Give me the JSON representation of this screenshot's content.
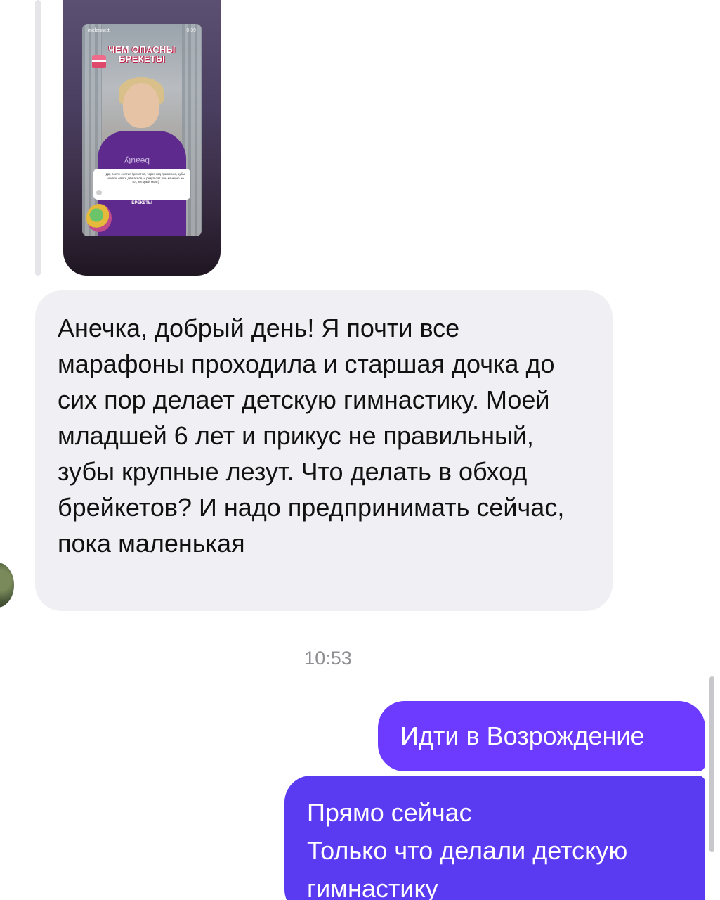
{
  "story_preview": {
    "username": "melannett",
    "duration": "0:39",
    "title_line1": "ЧЕМ ОПАСНЫ",
    "title_line2": "БРЕКЕТЫ",
    "shirt_text": "beauty",
    "quote_text": "Да, после снятия брекетов, через год примерно, зубы начали опять двигаться, и результат уже конечно не тот, который был (",
    "label": "БРЕКЕТЫ"
  },
  "incoming_message": {
    "text": "Анечка, добрый день! Я почти все марафоны проходила и старшая дочка до сих пор делает детскую гимнастику. Моей младшей 6 лет и прикус не правильный, зубы крупные лезут. Что делать в обход брейкетов? И надо предпринимать сейчас, пока маленькая"
  },
  "timestamp": "10:53",
  "outgoing_messages": [
    {
      "text": "Идти в Возрождение"
    },
    {
      "lines": [
        "Прямо сейчас",
        "Только что делали детскую",
        "гимнастику"
      ]
    }
  ],
  "colors": {
    "incoming_bubble": "#efeff4",
    "outgoing_bubble": "#6c3bff",
    "timestamp": "#8e8e93"
  }
}
